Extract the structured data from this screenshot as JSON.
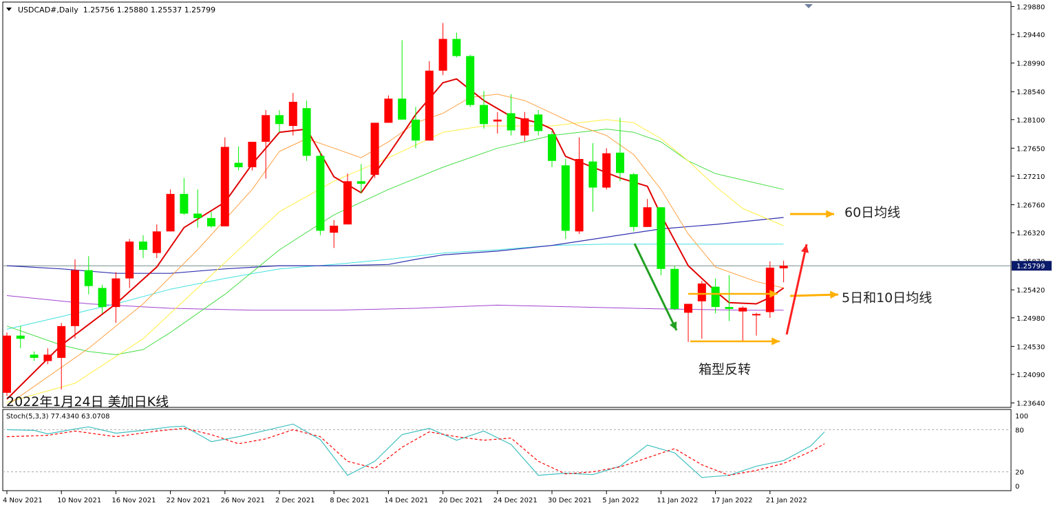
{
  "header": {
    "symbol": "USDCAD#,Daily",
    "ohlc": "1.25756 1.25880 1.25537 1.25799"
  },
  "subtitle": "2022年1月24日 美加日K线",
  "annotations": {
    "ma60": "60日均线",
    "ma5_10": "5日和10日均线",
    "box": "箱型反转"
  },
  "colors": {
    "up": "#ff0000",
    "down": "#00ee00",
    "ma5": "#e00000",
    "ma10": "#ffa040",
    "ma20": "#ffee40",
    "ma40": "#44dd44",
    "ma60": "#3030b0",
    "ma100": "#40e0e0",
    "ma200": "#a040d0",
    "arrow_orange": "#ffb000",
    "arrow_green": "#20a020",
    "arrow_red": "#ff2020",
    "stoch_main": "#40c0c0",
    "stoch_signal": "#ff0000"
  },
  "chart_data": {
    "type": "candlestick",
    "price_axis": {
      "ticks": [
        "1.29880",
        "1.29440",
        "1.28990",
        "1.28540",
        "1.28100",
        "1.27650",
        "1.27210",
        "1.26760",
        "1.26320",
        "1.25420",
        "1.24980",
        "1.24530",
        "1.24090",
        "1.23640"
      ],
      "current_price": "1.25799",
      "current_price_hidden": "1.25870",
      "ylim": [
        1.2357,
        1.2995
      ]
    },
    "x_ticks": [
      {
        "idx": 0,
        "label": "4 Nov 2021"
      },
      {
        "idx": 4,
        "label": "10 Nov 2021"
      },
      {
        "idx": 8,
        "label": "16 Nov 2021"
      },
      {
        "idx": 12,
        "label": "22 Nov 2021"
      },
      {
        "idx": 16,
        "label": "26 Nov 2021"
      },
      {
        "idx": 20,
        "label": "2 Dec 2021"
      },
      {
        "idx": 24,
        "label": "8 Dec 2021"
      },
      {
        "idx": 28,
        "label": "14 Dec 2021"
      },
      {
        "idx": 32,
        "label": "20 Dec 2021"
      },
      {
        "idx": 36,
        "label": "24 Dec 2021"
      },
      {
        "idx": 40,
        "label": "30 Dec 2021"
      },
      {
        "idx": 44,
        "label": "5 Jan 2022"
      },
      {
        "idx": 48,
        "label": "11 Jan 2022"
      },
      {
        "idx": 52,
        "label": "17 Jan 2022"
      },
      {
        "idx": 56,
        "label": "21 Jan 2022"
      }
    ],
    "candles": [
      [
        1.238,
        1.247,
        1.2375,
        1.2475
      ],
      [
        1.247,
        1.2465,
        1.245,
        1.2485
      ],
      [
        1.244,
        1.2435,
        1.243,
        1.2445
      ],
      [
        1.243,
        1.244,
        1.2425,
        1.245
      ],
      [
        1.2435,
        1.2485,
        1.2385,
        1.249
      ],
      [
        1.2485,
        1.2573,
        1.2465,
        1.259
      ],
      [
        1.2573,
        1.2548,
        1.2535,
        1.2595
      ],
      [
        1.2545,
        1.2515,
        1.2505,
        1.255
      ],
      [
        1.2515,
        1.256,
        1.249,
        1.257
      ],
      [
        1.256,
        1.2618,
        1.2545,
        1.2622
      ],
      [
        1.2618,
        1.2605,
        1.2592,
        1.2628
      ],
      [
        1.26,
        1.2634,
        1.2592,
        1.2645
      ],
      [
        1.2634,
        1.2693,
        1.2634,
        1.27
      ],
      [
        1.2693,
        1.2662,
        1.266,
        1.2718
      ],
      [
        1.2662,
        1.2655,
        1.264,
        1.27
      ],
      [
        1.2655,
        1.2642,
        1.264,
        1.2665
      ],
      [
        1.2642,
        1.2767,
        1.2642,
        1.2782
      ],
      [
        1.2742,
        1.2735,
        1.273,
        1.2768
      ],
      [
        1.2735,
        1.2775,
        1.273,
        1.2775
      ],
      [
        1.2775,
        1.2817,
        1.2717,
        1.2825
      ],
      [
        1.2817,
        1.2803,
        1.279,
        1.2825
      ],
      [
        1.28,
        1.2838,
        1.2785,
        1.2852
      ],
      [
        1.2828,
        1.2753,
        1.2745,
        1.284
      ],
      [
        1.2753,
        1.2635,
        1.2628,
        1.276
      ],
      [
        1.2632,
        1.2643,
        1.2608,
        1.2652
      ],
      [
        1.2645,
        1.2713,
        1.2645,
        1.2725
      ],
      [
        1.2713,
        1.2709,
        1.2694,
        1.274
      ],
      [
        1.2723,
        1.2805,
        1.2718,
        1.2805
      ],
      [
        1.2805,
        1.2843,
        1.2805,
        1.2848
      ],
      [
        1.2843,
        1.281,
        1.281,
        1.2935
      ],
      [
        1.281,
        1.2777,
        1.2765,
        1.283
      ],
      [
        1.2777,
        1.2887,
        1.2777,
        1.2902
      ],
      [
        1.2887,
        1.2937,
        1.288,
        1.2962
      ],
      [
        1.2937,
        1.291,
        1.2908,
        1.2947
      ],
      [
        1.291,
        1.2833,
        1.283,
        1.2912
      ],
      [
        1.2833,
        1.2803,
        1.2796,
        1.2855
      ],
      [
        1.2807,
        1.281,
        1.2788,
        1.2822
      ],
      [
        1.282,
        1.2793,
        1.2785,
        1.285
      ],
      [
        1.2785,
        1.2812,
        1.2776,
        1.2822
      ],
      [
        1.2818,
        1.2792,
        1.2785,
        1.2825
      ],
      [
        1.2787,
        1.2745,
        1.2735,
        1.2792
      ],
      [
        1.2738,
        1.2635,
        1.2622,
        1.2748
      ],
      [
        1.2634,
        1.2748,
        1.263,
        1.2782
      ],
      [
        1.2744,
        1.2703,
        1.2665,
        1.2773
      ],
      [
        1.2703,
        1.2757,
        1.27,
        1.2765
      ],
      [
        1.2758,
        1.2726,
        1.2713,
        1.2813
      ],
      [
        1.2724,
        1.2641,
        1.2634,
        1.2726
      ],
      [
        1.2641,
        1.2672,
        1.2641,
        1.2685
      ],
      [
        1.2672,
        1.2575,
        1.2565,
        1.2672
      ],
      [
        1.2575,
        1.2512,
        1.251,
        1.258
      ],
      [
        1.2506,
        1.252,
        1.246,
        1.252
      ],
      [
        1.2524,
        1.2552,
        1.2465,
        1.2556
      ],
      [
        1.2547,
        1.2515,
        1.2505,
        1.256
      ],
      [
        1.2515,
        1.2512,
        1.2493,
        1.2565
      ],
      [
        1.2508,
        1.2514,
        1.246,
        1.2516
      ],
      [
        1.2504,
        1.2504,
        1.247,
        1.2506
      ],
      [
        1.2507,
        1.2577,
        1.2498,
        1.2587
      ],
      [
        1.2576,
        1.258,
        1.2554,
        1.2588
      ]
    ],
    "moving_averages": {
      "ma5": [
        [
          0,
          1.237
        ],
        [
          4,
          1.2455
        ],
        [
          8,
          1.252
        ],
        [
          11,
          1.2578
        ],
        [
          13,
          1.264
        ],
        [
          16,
          1.268
        ],
        [
          18,
          1.274
        ],
        [
          20,
          1.279
        ],
        [
          22,
          1.2795
        ],
        [
          24,
          1.272
        ],
        [
          26,
          1.2695
        ],
        [
          28,
          1.2755
        ],
        [
          30,
          1.2818
        ],
        [
          32,
          1.2868
        ],
        [
          33,
          1.2874
        ],
        [
          35,
          1.284
        ],
        [
          37,
          1.2815
        ],
        [
          39,
          1.2805
        ],
        [
          40,
          1.2795
        ],
        [
          41,
          1.2752
        ],
        [
          43,
          1.2735
        ],
        [
          45,
          1.2718
        ],
        [
          47,
          1.2705
        ],
        [
          48,
          1.266
        ],
        [
          50,
          1.258
        ],
        [
          52,
          1.254
        ],
        [
          53,
          1.2522
        ],
        [
          55,
          1.252
        ],
        [
          56,
          1.253
        ],
        [
          57,
          1.2545
        ]
      ],
      "ma10": [
        [
          0,
          1.236
        ],
        [
          6,
          1.245
        ],
        [
          10,
          1.252
        ],
        [
          14,
          1.2605
        ],
        [
          18,
          1.27
        ],
        [
          20,
          1.276
        ],
        [
          22,
          1.278
        ],
        [
          24,
          1.2765
        ],
        [
          26,
          1.275
        ],
        [
          28,
          1.2775
        ],
        [
          30,
          1.2805
        ],
        [
          32,
          1.282
        ],
        [
          34,
          1.2845
        ],
        [
          36,
          1.285
        ],
        [
          38,
          1.284
        ],
        [
          40,
          1.282
        ],
        [
          42,
          1.28
        ],
        [
          44,
          1.2785
        ],
        [
          46,
          1.2755
        ],
        [
          48,
          1.27
        ],
        [
          50,
          1.263
        ],
        [
          52,
          1.2578
        ],
        [
          55,
          1.2555
        ],
        [
          57,
          1.2545
        ]
      ],
      "ma20": [
        [
          0,
          1.2365
        ],
        [
          5,
          1.2395
        ],
        [
          10,
          1.2465
        ],
        [
          15,
          1.2565
        ],
        [
          20,
          1.2665
        ],
        [
          24,
          1.2713
        ],
        [
          28,
          1.275
        ],
        [
          32,
          1.279
        ],
        [
          35,
          1.28
        ],
        [
          40,
          1.28
        ],
        [
          44,
          1.281
        ],
        [
          46,
          1.2805
        ],
        [
          48,
          1.278
        ],
        [
          50,
          1.2745
        ],
        [
          52,
          1.2705
        ],
        [
          54,
          1.267
        ],
        [
          57,
          1.2643
        ]
      ],
      "ma40": [
        [
          0,
          1.2485
        ],
        [
          4,
          1.2455
        ],
        [
          6,
          1.2445
        ],
        [
          8,
          1.244
        ],
        [
          10,
          1.2448
        ],
        [
          12,
          1.2475
        ],
        [
          16,
          1.2535
        ],
        [
          20,
          1.2605
        ],
        [
          24,
          1.266
        ],
        [
          28,
          1.27
        ],
        [
          32,
          1.2735
        ],
        [
          36,
          1.2765
        ],
        [
          40,
          1.2785
        ],
        [
          44,
          1.2795
        ],
        [
          46,
          1.279
        ],
        [
          48,
          1.2775
        ],
        [
          50,
          1.2745
        ],
        [
          52,
          1.2725
        ],
        [
          54,
          1.2715
        ],
        [
          57,
          1.27
        ]
      ],
      "ma60": [
        [
          0,
          1.258
        ],
        [
          4,
          1.2575
        ],
        [
          8,
          1.2568
        ],
        [
          12,
          1.2568
        ],
        [
          16,
          1.2575
        ],
        [
          20,
          1.258
        ],
        [
          24,
          1.258
        ],
        [
          28,
          1.2582
        ],
        [
          30,
          1.259
        ],
        [
          32,
          1.2597
        ],
        [
          36,
          1.2603
        ],
        [
          40,
          1.2612
        ],
        [
          44,
          1.2625
        ],
        [
          48,
          1.2638
        ],
        [
          52,
          1.2645
        ],
        [
          57,
          1.2656
        ]
      ],
      "ma100": [
        [
          0,
          1.248
        ],
        [
          4,
          1.25
        ],
        [
          8,
          1.252
        ],
        [
          12,
          1.2543
        ],
        [
          16,
          1.256
        ],
        [
          20,
          1.2575
        ],
        [
          24,
          1.2582
        ],
        [
          28,
          1.259
        ],
        [
          32,
          1.26
        ],
        [
          36,
          1.2605
        ],
        [
          40,
          1.2612
        ],
        [
          44,
          1.2614
        ],
        [
          48,
          1.2614
        ],
        [
          57,
          1.2614
        ]
      ],
      "ma200": [
        [
          0,
          1.2533
        ],
        [
          6,
          1.252
        ],
        [
          12,
          1.2513
        ],
        [
          18,
          1.251
        ],
        [
          24,
          1.251
        ],
        [
          30,
          1.2513
        ],
        [
          36,
          1.2518
        ],
        [
          42,
          1.2515
        ],
        [
          48,
          1.2512
        ],
        [
          54,
          1.251
        ],
        [
          57,
          1.251
        ]
      ]
    },
    "stochastic": {
      "label": "Stoch(5,3,3) 77.4340 63.0708",
      "levels": [
        "100",
        "80",
        "20",
        "0"
      ],
      "main": [
        [
          0,
          80
        ],
        [
          2,
          79
        ],
        [
          3,
          74
        ],
        [
          5,
          81
        ],
        [
          6,
          84
        ],
        [
          8,
          75
        ],
        [
          10,
          79
        ],
        [
          12,
          84
        ],
        [
          13,
          85
        ],
        [
          15,
          63
        ],
        [
          17,
          70
        ],
        [
          19,
          79
        ],
        [
          21,
          88
        ],
        [
          23,
          66
        ],
        [
          25,
          15
        ],
        [
          27,
          35
        ],
        [
          29,
          73
        ],
        [
          31,
          82
        ],
        [
          33,
          65
        ],
        [
          35,
          78
        ],
        [
          37,
          59
        ],
        [
          39,
          15
        ],
        [
          41,
          18
        ],
        [
          43,
          16
        ],
        [
          45,
          28
        ],
        [
          47,
          58
        ],
        [
          49,
          47
        ],
        [
          51,
          12
        ],
        [
          53,
          15
        ],
        [
          55,
          28
        ],
        [
          57,
          36
        ],
        [
          59,
          57
        ],
        [
          60,
          77
        ]
      ],
      "signal": [
        [
          0,
          70
        ],
        [
          3,
          72
        ],
        [
          5,
          78
        ],
        [
          8,
          70
        ],
        [
          11,
          78
        ],
        [
          13,
          82
        ],
        [
          15,
          73
        ],
        [
          17,
          60
        ],
        [
          19,
          67
        ],
        [
          21,
          80
        ],
        [
          23,
          70
        ],
        [
          25,
          35
        ],
        [
          27,
          25
        ],
        [
          29,
          55
        ],
        [
          31,
          77
        ],
        [
          33,
          70
        ],
        [
          35,
          65
        ],
        [
          37,
          68
        ],
        [
          39,
          35
        ],
        [
          41,
          17
        ],
        [
          43,
          20
        ],
        [
          45,
          27
        ],
        [
          47,
          40
        ],
        [
          49,
          53
        ],
        [
          51,
          30
        ],
        [
          53,
          15
        ],
        [
          55,
          22
        ],
        [
          57,
          32
        ],
        [
          59,
          49
        ],
        [
          60,
          60
        ]
      ]
    }
  }
}
